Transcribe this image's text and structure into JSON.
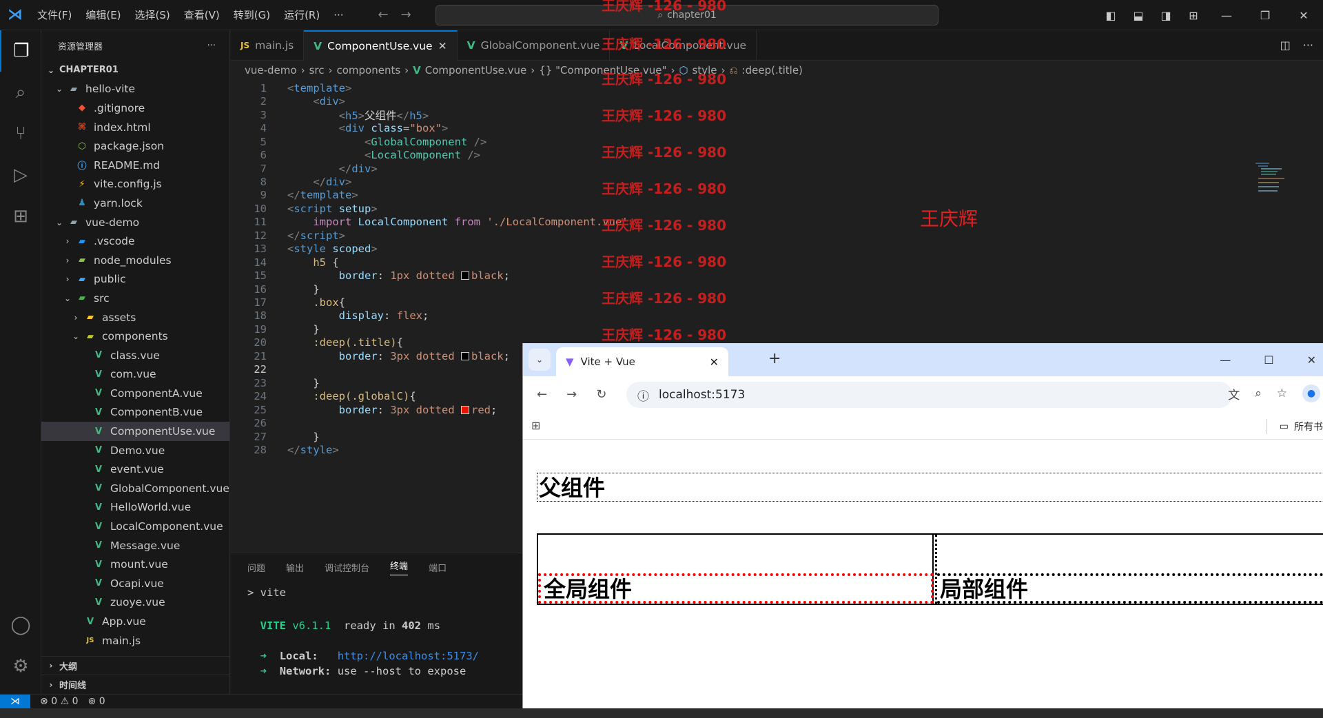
{
  "titlebar": {
    "menu": [
      "文件(F)",
      "编辑(E)",
      "选择(S)",
      "查看(V)",
      "转到(G)",
      "运行(R)",
      "···"
    ],
    "search": "chapter01"
  },
  "sidebar": {
    "title": "资源管理器",
    "more": "···",
    "rows": [
      {
        "label": "CHAPTER01",
        "depth": 0,
        "chev": "⌄",
        "icon": "",
        "kind": "root"
      },
      {
        "label": "hello-vite",
        "depth": 1,
        "chev": "⌄",
        "icon": "folder-open-icon",
        "kind": "folder"
      },
      {
        "label": ".gitignore",
        "depth": 2,
        "chev": "",
        "icon": "git-icon",
        "kind": "file"
      },
      {
        "label": "index.html",
        "depth": 2,
        "chev": "",
        "icon": "html-icon",
        "kind": "file"
      },
      {
        "label": "package.json",
        "depth": 2,
        "chev": "",
        "icon": "node-icon",
        "kind": "file"
      },
      {
        "label": "README.md",
        "depth": 2,
        "chev": "",
        "icon": "info-icon",
        "kind": "file"
      },
      {
        "label": "vite.config.js",
        "depth": 2,
        "chev": "",
        "icon": "vite-icon",
        "kind": "file"
      },
      {
        "label": "yarn.lock",
        "depth": 2,
        "chev": "",
        "icon": "yarn-icon",
        "kind": "file"
      },
      {
        "label": "vue-demo",
        "depth": 1,
        "chev": "⌄",
        "icon": "folder-open-icon",
        "kind": "folder"
      },
      {
        "label": ".vscode",
        "depth": 2,
        "chev": "›",
        "icon": "folder-vscode-icon",
        "kind": "folder"
      },
      {
        "label": "node_modules",
        "depth": 2,
        "chev": "›",
        "icon": "folder-node-icon",
        "kind": "folder"
      },
      {
        "label": "public",
        "depth": 2,
        "chev": "›",
        "icon": "folder-public-icon",
        "kind": "folder"
      },
      {
        "label": "src",
        "depth": 2,
        "chev": "⌄",
        "icon": "folder-src-icon",
        "kind": "folder"
      },
      {
        "label": "assets",
        "depth": 3,
        "chev": "›",
        "icon": "folder-assets-icon",
        "kind": "folder"
      },
      {
        "label": "components",
        "depth": 3,
        "chev": "⌄",
        "icon": "folder-components-icon",
        "kind": "folder"
      },
      {
        "label": "class.vue",
        "depth": 4,
        "chev": "",
        "icon": "vue-icon",
        "kind": "vue"
      },
      {
        "label": "com.vue",
        "depth": 4,
        "chev": "",
        "icon": "vue-icon",
        "kind": "vue"
      },
      {
        "label": "ComponentA.vue",
        "depth": 4,
        "chev": "",
        "icon": "vue-icon",
        "kind": "vue"
      },
      {
        "label": "ComponentB.vue",
        "depth": 4,
        "chev": "",
        "icon": "vue-icon",
        "kind": "vue"
      },
      {
        "label": "ComponentUse.vue",
        "depth": 4,
        "chev": "",
        "icon": "vue-icon",
        "kind": "vue",
        "selected": true
      },
      {
        "label": "Demo.vue",
        "depth": 4,
        "chev": "",
        "icon": "vue-icon",
        "kind": "vue"
      },
      {
        "label": "event.vue",
        "depth": 4,
        "chev": "",
        "icon": "vue-icon",
        "kind": "vue"
      },
      {
        "label": "GlobalComponent.vue",
        "depth": 4,
        "chev": "",
        "icon": "vue-icon",
        "kind": "vue"
      },
      {
        "label": "HelloWorld.vue",
        "depth": 4,
        "chev": "",
        "icon": "vue-icon",
        "kind": "vue"
      },
      {
        "label": "LocalComponent.vue",
        "depth": 4,
        "chev": "",
        "icon": "vue-icon",
        "kind": "vue"
      },
      {
        "label": "Message.vue",
        "depth": 4,
        "chev": "",
        "icon": "vue-icon",
        "kind": "vue"
      },
      {
        "label": "mount.vue",
        "depth": 4,
        "chev": "",
        "icon": "vue-icon",
        "kind": "vue"
      },
      {
        "label": "Ocapi.vue",
        "depth": 4,
        "chev": "",
        "icon": "vue-icon",
        "kind": "vue"
      },
      {
        "label": "zuoye.vue",
        "depth": 4,
        "chev": "",
        "icon": "vue-icon",
        "kind": "vue"
      },
      {
        "label": "App.vue",
        "depth": 3,
        "chev": "",
        "icon": "vue-icon",
        "kind": "vue"
      },
      {
        "label": "main.js",
        "depth": 3,
        "chev": "",
        "icon": "js-icon",
        "kind": "js"
      }
    ],
    "outline": "大纲",
    "timeline": "时间线"
  },
  "tabs": [
    {
      "label": "main.js",
      "icon": "js-icon",
      "active": false
    },
    {
      "label": "ComponentUse.vue",
      "icon": "vue-icon",
      "active": true
    },
    {
      "label": "GlobalComponent.vue",
      "icon": "vue-icon",
      "active": false
    },
    {
      "label": "LocalComponent.vue",
      "icon": "vue-icon",
      "active": false
    }
  ],
  "breadcrumbs": [
    "vue-demo",
    "src",
    "components",
    "ComponentUse.vue",
    "{} \"ComponentUse.vue\"",
    "style",
    ":deep(.title)"
  ],
  "code": {
    "current_line": 22,
    "lines": [
      [
        [
          "t-gray",
          "<"
        ],
        [
          "t-tag",
          "template"
        ],
        [
          "t-gray",
          ">"
        ]
      ],
      [
        [
          "t-txt",
          "    "
        ],
        [
          "t-gray",
          "<"
        ],
        [
          "t-tag",
          "div"
        ],
        [
          "t-gray",
          ">"
        ]
      ],
      [
        [
          "t-txt",
          "        "
        ],
        [
          "t-gray",
          "<"
        ],
        [
          "t-tag",
          "h5"
        ],
        [
          "t-gray",
          ">"
        ],
        [
          "t-txt",
          "父组件"
        ],
        [
          "t-gray",
          "</"
        ],
        [
          "t-tag",
          "h5"
        ],
        [
          "t-gray",
          ">"
        ]
      ],
      [
        [
          "t-txt",
          "        "
        ],
        [
          "t-gray",
          "<"
        ],
        [
          "t-tag",
          "div"
        ],
        [
          "t-txt",
          " "
        ],
        [
          "t-attr",
          "class"
        ],
        [
          "t-txt",
          "="
        ],
        [
          "t-str",
          "\"box\""
        ],
        [
          "t-gray",
          ">"
        ]
      ],
      [
        [
          "t-txt",
          "            "
        ],
        [
          "t-gray",
          "<"
        ],
        [
          "t-comp",
          "GlobalComponent"
        ],
        [
          "t-txt",
          " "
        ],
        [
          "t-gray",
          "/>"
        ]
      ],
      [
        [
          "t-txt",
          "            "
        ],
        [
          "t-gray",
          "<"
        ],
        [
          "t-comp",
          "LocalComponent"
        ],
        [
          "t-txt",
          " "
        ],
        [
          "t-gray",
          "/>"
        ]
      ],
      [
        [
          "t-txt",
          "        "
        ],
        [
          "t-gray",
          "</"
        ],
        [
          "t-tag",
          "div"
        ],
        [
          "t-gray",
          ">"
        ]
      ],
      [
        [
          "t-txt",
          "    "
        ],
        [
          "t-gray",
          "</"
        ],
        [
          "t-tag",
          "div"
        ],
        [
          "t-gray",
          ">"
        ]
      ],
      [
        [
          "t-gray",
          "</"
        ],
        [
          "t-tag",
          "template"
        ],
        [
          "t-gray",
          ">"
        ]
      ],
      [
        [
          "t-gray",
          "<"
        ],
        [
          "t-tag",
          "script"
        ],
        [
          "t-txt",
          " "
        ],
        [
          "t-attr",
          "setup"
        ],
        [
          "t-gray",
          ">"
        ]
      ],
      [
        [
          "t-txt",
          "    "
        ],
        [
          "t-kw",
          "import"
        ],
        [
          "t-txt",
          " "
        ],
        [
          "t-attr",
          "LocalComponent"
        ],
        [
          "t-txt",
          " "
        ],
        [
          "t-kw",
          "from"
        ],
        [
          "t-txt",
          " "
        ],
        [
          "t-str",
          "'./LocalComponent.vue'"
        ]
      ],
      [
        [
          "t-gray",
          "</"
        ],
        [
          "t-tag",
          "script"
        ],
        [
          "t-gray",
          ">"
        ]
      ],
      [
        [
          "t-gray",
          "<"
        ],
        [
          "t-tag",
          "style"
        ],
        [
          "t-txt",
          " "
        ],
        [
          "t-attr",
          "scoped"
        ],
        [
          "t-gray",
          ">"
        ]
      ],
      [
        [
          "t-txt",
          "    "
        ],
        [
          "t-sel",
          "h5"
        ],
        [
          "t-txt",
          " {"
        ]
      ],
      [
        [
          "t-txt",
          "        "
        ],
        [
          "t-prop",
          "border"
        ],
        [
          "t-txt",
          ": "
        ],
        [
          "t-val",
          "1px dotted "
        ],
        [
          "sw",
          "#000000"
        ],
        [
          "t-val",
          "black"
        ],
        [
          "t-txt",
          ";"
        ]
      ],
      [
        [
          "t-txt",
          "    }"
        ]
      ],
      [
        [
          "t-txt",
          "    "
        ],
        [
          "t-sel",
          ".box"
        ],
        [
          "t-txt",
          "{"
        ]
      ],
      [
        [
          "t-txt",
          "        "
        ],
        [
          "t-prop",
          "display"
        ],
        [
          "t-txt",
          ": "
        ],
        [
          "t-val",
          "flex"
        ],
        [
          "t-txt",
          ";"
        ]
      ],
      [
        [
          "t-txt",
          "    }"
        ]
      ],
      [
        [
          "t-txt",
          "    "
        ],
        [
          "t-sel",
          ":deep(.title)"
        ],
        [
          "t-txt",
          "{"
        ]
      ],
      [
        [
          "t-txt",
          "        "
        ],
        [
          "t-prop",
          "border"
        ],
        [
          "t-txt",
          ": "
        ],
        [
          "t-val",
          "3px dotted "
        ],
        [
          "sw",
          "#000000"
        ],
        [
          "t-val",
          "black"
        ],
        [
          "t-txt",
          ";"
        ]
      ],
      [
        [
          "t-txt",
          ""
        ]
      ],
      [
        [
          "t-txt",
          "    }"
        ]
      ],
      [
        [
          "t-txt",
          "    "
        ],
        [
          "t-sel",
          ":deep(.globalC)"
        ],
        [
          "t-txt",
          "{"
        ]
      ],
      [
        [
          "t-txt",
          "        "
        ],
        [
          "t-prop",
          "border"
        ],
        [
          "t-txt",
          ": "
        ],
        [
          "t-val",
          "3px dotted "
        ],
        [
          "sw",
          "#e51400"
        ],
        [
          "t-val",
          "red"
        ],
        [
          "t-txt",
          ";"
        ]
      ],
      [
        [
          "t-txt",
          ""
        ]
      ],
      [
        [
          "t-txt",
          "    }"
        ]
      ],
      [
        [
          "t-gray",
          "</"
        ],
        [
          "t-tag",
          "style"
        ],
        [
          "t-gray",
          ">"
        ]
      ]
    ]
  },
  "watermark": {
    "text": "王庆辉 -126 - 980",
    "name": "王庆辉"
  },
  "panel": {
    "tabs": [
      "问题",
      "输出",
      "调试控制台",
      "终端",
      "端口"
    ],
    "active_tab": "终端",
    "prompt": "> vite",
    "vite_name": "VITE",
    "vite_version": "v6.1.1",
    "ready_pre": "ready in",
    "ready_ms": "402",
    "ready_unit": "ms",
    "local_label": "Local:",
    "local_url": "http://localhost:5173/",
    "network_label": "Network:",
    "network_text": "use --host to expose"
  },
  "status": {
    "errors": "0",
    "warnings": "0",
    "ports": "0"
  },
  "browser": {
    "tab_title": "Vite + Vue",
    "url": "localhost:5173",
    "bookmarks": "所有书",
    "page": {
      "h5": "父组件",
      "global": "全局组件",
      "local": "局部组件"
    }
  },
  "colors": {
    "accent": "#0078d4",
    "vue_green": "#41b883",
    "watermark_red": "#e02020",
    "terminal_green": "#23d18b",
    "terminal_link": "#3b8eea"
  }
}
